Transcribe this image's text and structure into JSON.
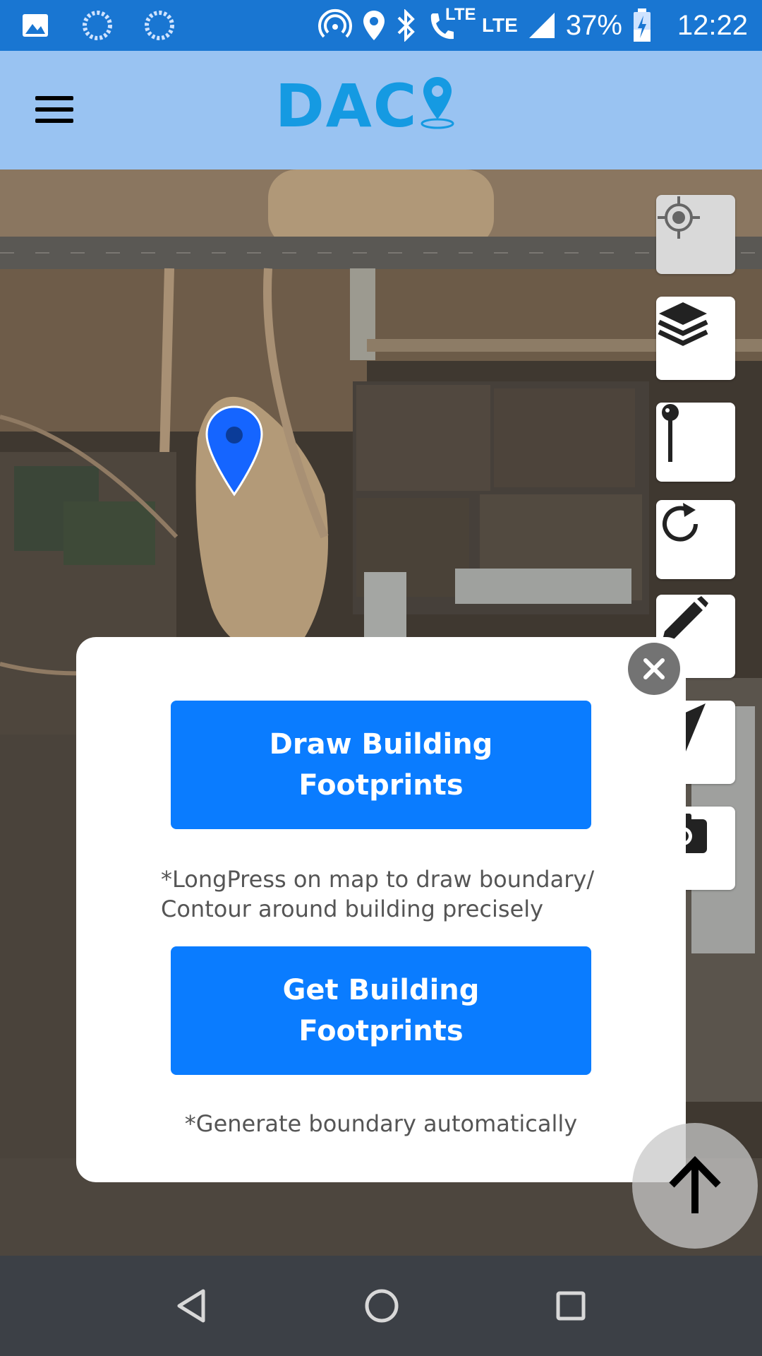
{
  "status_bar": {
    "battery": "37%",
    "time": "12:22",
    "signal_label_1": "LTE",
    "signal_label_2": "LTE"
  },
  "app": {
    "logo_text": "DAC",
    "colors": {
      "appbar": "#99c3f2",
      "statusbar": "#1976d2",
      "primary_button": "#0a7cff",
      "logo": "#159ae2"
    }
  },
  "map_controls": [
    "my-location-icon",
    "layers-icon",
    "pin-icon",
    "refresh-icon",
    "pencil-icon",
    "navigate-icon",
    "camera-icon"
  ],
  "modal": {
    "draw_button_line1": "Draw Building",
    "draw_button_line2": "Footprints",
    "draw_hint_line1": "*LongPress on map to draw boundary/",
    "draw_hint_line2": "Contour around building precisely",
    "get_button_line1": "Get Building",
    "get_button_line2": "Footprints",
    "get_hint": "*Generate boundary automatically"
  }
}
